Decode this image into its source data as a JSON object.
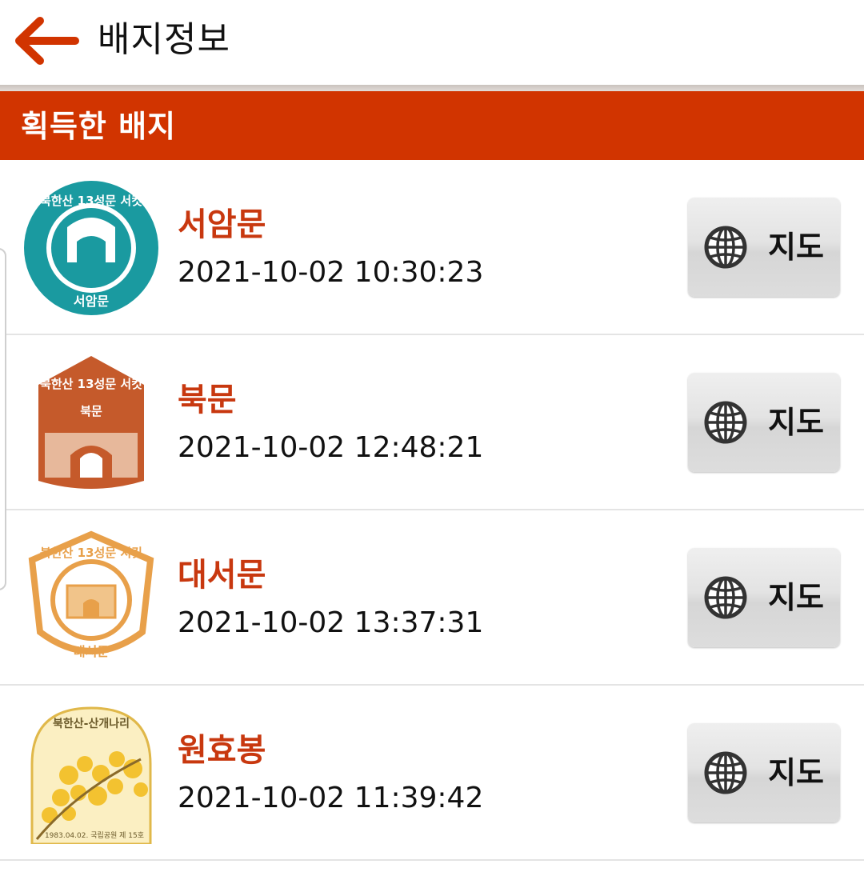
{
  "header": {
    "title": "배지정보",
    "back_icon": "back-arrow-icon",
    "accent": "#d13400"
  },
  "section": {
    "title": "획득한 배지"
  },
  "badges": [
    {
      "name": "서암문",
      "time": "2021-10-02 10:30:23",
      "map_label": "지도",
      "stamp_text": "북한산 13성문 서킷",
      "stamp_sub": "서암문",
      "color": "#1a9aa0"
    },
    {
      "name": "북문",
      "time": "2021-10-02 12:48:21",
      "map_label": "지도",
      "stamp_text": "북한산 13성문 서킷",
      "stamp_sub": "북문",
      "color": "#c55a2b"
    },
    {
      "name": "대서문",
      "time": "2021-10-02 13:37:31",
      "map_label": "지도",
      "stamp_text": "북한산 13성문 서킷",
      "stamp_sub": "대서문",
      "color": "#e8a04a"
    },
    {
      "name": "원효봉",
      "time": "2021-10-02 11:39:42",
      "map_label": "지도",
      "stamp_text": "북한산-산개나리",
      "stamp_sub": "1983.04.02. 국립공원 제 15호",
      "color": "#f3c230"
    }
  ]
}
